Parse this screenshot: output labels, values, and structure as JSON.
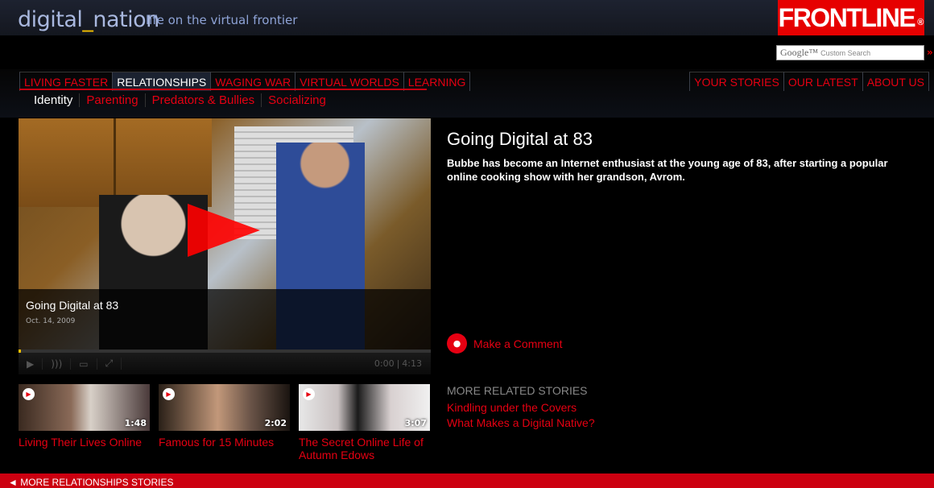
{
  "header": {
    "brand_pre": "digital",
    "brand_under": "_",
    "brand_post": "nation",
    "tagline": "life on the virtual frontier",
    "logo": "FRONTLINE",
    "logo_mark": "®"
  },
  "search": {
    "google": "Google™",
    "placeholder": "Custom Search",
    "go": "»"
  },
  "nav": {
    "left": [
      {
        "label": "LIVING FASTER"
      },
      {
        "label": "RELATIONSHIPS",
        "active": true
      },
      {
        "label": "WAGING WAR"
      },
      {
        "label": "VIRTUAL WORLDS"
      },
      {
        "label": "LEARNING"
      }
    ],
    "right": [
      {
        "label": "YOUR STORIES"
      },
      {
        "label": "OUR LATEST"
      },
      {
        "label": "ABOUT US"
      }
    ]
  },
  "subnav": [
    "Identity",
    "Parenting",
    "Predators & Bullies",
    "Socializing"
  ],
  "video": {
    "title": "Going Digital at 83",
    "date": "Oct. 14, 2009",
    "current_time": "0:00",
    "duration": "4:13",
    "progress": 0.0
  },
  "story": {
    "title": "Going Digital at 83",
    "description": "Bubbe has become an Internet enthusiast at the young age of 83, after starting a popular online cooking show with her grandson, Avrom."
  },
  "comment": {
    "label": "Make a Comment"
  },
  "related": {
    "heading": "MORE RELATED STORIES",
    "links": [
      "Kindling under the Covers",
      "What Makes a Digital Native?"
    ]
  },
  "thumbnails": [
    {
      "title": "Living Their Lives Online",
      "duration": "1:48"
    },
    {
      "title": "Famous for 15 Minutes",
      "duration": "2:02"
    },
    {
      "title": "The Secret Online Life of Autumn Edows",
      "duration": "3:07"
    }
  ],
  "footer": {
    "label": "◄ MORE RELATIONSHIPS STORIES"
  },
  "colors": {
    "accent": "#e60012",
    "logo_bg": "#e60000",
    "nav_active_bg": "#1b2230",
    "brand_text": "#a9b8df"
  }
}
